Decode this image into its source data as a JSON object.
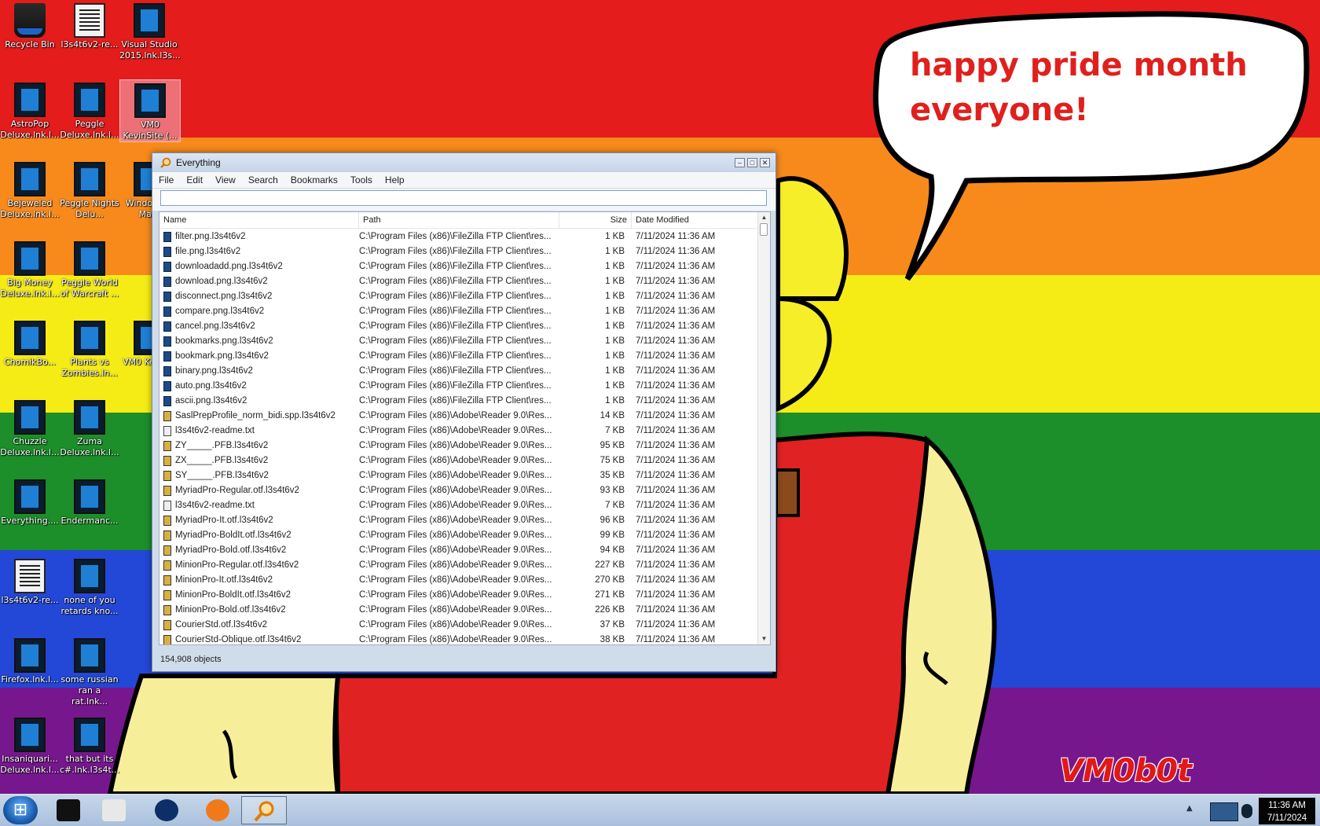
{
  "wallpaper": {
    "speech_line1": "happy pride month",
    "speech_line2": "everyone!",
    "signature": "VM0b0t",
    "stripe_colors": [
      "#e41c1c",
      "#f88a1c",
      "#f6ec15",
      "#1c8e2a",
      "#2347d6",
      "#76178e"
    ]
  },
  "desktop_icons": [
    {
      "label": "Recycle Bin",
      "icon": "recycle-bin-icon"
    },
    {
      "label": "l3s4t6v2-re...",
      "icon": "text-document-icon"
    },
    {
      "label": "Visual Studio 2015.lnk.l3s...",
      "icon": "shortcut-icon"
    },
    {
      "label": "AstroPop Deluxe.lnk.l...",
      "icon": "shortcut-icon"
    },
    {
      "label": "Peggle Deluxe.lnk.l...",
      "icon": "shortcut-icon"
    },
    {
      "label": "VM0 KevinSite (...",
      "icon": "shortcut-icon"
    },
    {
      "label": "Bejeweled Deluxe.lnk.l...",
      "icon": "shortcut-icon"
    },
    {
      "label": "Peggle Nights Delu...",
      "icon": "shortcut-icon"
    },
    {
      "label": "Windo Live Ma...",
      "icon": "shortcut-icon"
    },
    {
      "label": "Big Money Deluxe.lnk.l...",
      "icon": "shortcut-icon"
    },
    {
      "label": "Peggle World of Warcraft ...",
      "icon": "shortcut-icon"
    },
    {
      "label": "ChomikBo...",
      "icon": "shortcut-icon"
    },
    {
      "label": "Plants vs Zombies.ln...",
      "icon": "shortcut-icon"
    },
    {
      "label": "VM0 Kevin...",
      "icon": "shortcut-icon"
    },
    {
      "label": "Chuzzle Deluxe.lnk.l...",
      "icon": "shortcut-icon"
    },
    {
      "label": "Zuma Deluxe.lnk.l...",
      "icon": "shortcut-icon"
    },
    {
      "label": "Everything....",
      "icon": "shortcut-icon"
    },
    {
      "label": "Endermanc...",
      "icon": "shortcut-icon"
    },
    {
      "label": "l3s4t6v2-re...",
      "icon": "text-document-icon"
    },
    {
      "label": "none of you retards kno...",
      "icon": "shortcut-icon"
    },
    {
      "label": "Firefox.lnk.l...",
      "icon": "shortcut-icon"
    },
    {
      "label": "some russian ran a rat.lnk...",
      "icon": "shortcut-icon"
    },
    {
      "label": "Insaniquari... Deluxe.lnk.l...",
      "icon": "shortcut-icon"
    },
    {
      "label": "that but its c#.lnk.l3s4t...",
      "icon": "shortcut-icon"
    }
  ],
  "window": {
    "title": "Everything",
    "menu": [
      "File",
      "Edit",
      "View",
      "Search",
      "Bookmarks",
      "Tools",
      "Help"
    ],
    "search_value": "",
    "columns": {
      "name": "Name",
      "path": "Path",
      "size": "Size",
      "date": "Date Modified"
    },
    "rows": [
      {
        "name": "filter.png.l3s4t6v2",
        "path": "C:\\Program Files (x86)\\FileZilla FTP Client\\res...",
        "size": "1 KB",
        "date": "7/11/2024 11:36 AM",
        "type": "file"
      },
      {
        "name": "file.png.l3s4t6v2",
        "path": "C:\\Program Files (x86)\\FileZilla FTP Client\\res...",
        "size": "1 KB",
        "date": "7/11/2024 11:36 AM",
        "type": "file"
      },
      {
        "name": "downloadadd.png.l3s4t6v2",
        "path": "C:\\Program Files (x86)\\FileZilla FTP Client\\res...",
        "size": "1 KB",
        "date": "7/11/2024 11:36 AM",
        "type": "file"
      },
      {
        "name": "download.png.l3s4t6v2",
        "path": "C:\\Program Files (x86)\\FileZilla FTP Client\\res...",
        "size": "1 KB",
        "date": "7/11/2024 11:36 AM",
        "type": "file"
      },
      {
        "name": "disconnect.png.l3s4t6v2",
        "path": "C:\\Program Files (x86)\\FileZilla FTP Client\\res...",
        "size": "1 KB",
        "date": "7/11/2024 11:36 AM",
        "type": "file"
      },
      {
        "name": "compare.png.l3s4t6v2",
        "path": "C:\\Program Files (x86)\\FileZilla FTP Client\\res...",
        "size": "1 KB",
        "date": "7/11/2024 11:36 AM",
        "type": "file"
      },
      {
        "name": "cancel.png.l3s4t6v2",
        "path": "C:\\Program Files (x86)\\FileZilla FTP Client\\res...",
        "size": "1 KB",
        "date": "7/11/2024 11:36 AM",
        "type": "file"
      },
      {
        "name": "bookmarks.png.l3s4t6v2",
        "path": "C:\\Program Files (x86)\\FileZilla FTP Client\\res...",
        "size": "1 KB",
        "date": "7/11/2024 11:36 AM",
        "type": "file"
      },
      {
        "name": "bookmark.png.l3s4t6v2",
        "path": "C:\\Program Files (x86)\\FileZilla FTP Client\\res...",
        "size": "1 KB",
        "date": "7/11/2024 11:36 AM",
        "type": "file"
      },
      {
        "name": "binary.png.l3s4t6v2",
        "path": "C:\\Program Files (x86)\\FileZilla FTP Client\\res...",
        "size": "1 KB",
        "date": "7/11/2024 11:36 AM",
        "type": "file"
      },
      {
        "name": "auto.png.l3s4t6v2",
        "path": "C:\\Program Files (x86)\\FileZilla FTP Client\\res...",
        "size": "1 KB",
        "date": "7/11/2024 11:36 AM",
        "type": "file"
      },
      {
        "name": "ascii.png.l3s4t6v2",
        "path": "C:\\Program Files (x86)\\FileZilla FTP Client\\res...",
        "size": "1 KB",
        "date": "7/11/2024 11:36 AM",
        "type": "file"
      },
      {
        "name": "SaslPrepProfile_norm_bidi.spp.l3s4t6v2",
        "path": "C:\\Program Files (x86)\\Adobe\\Reader 9.0\\Res...",
        "size": "14 KB",
        "date": "7/11/2024 11:36 AM",
        "type": "font"
      },
      {
        "name": "l3s4t6v2-readme.txt",
        "path": "C:\\Program Files (x86)\\Adobe\\Reader 9.0\\Res...",
        "size": "7 KB",
        "date": "7/11/2024 11:36 AM",
        "type": "txt"
      },
      {
        "name": "ZY_____.PFB.l3s4t6v2",
        "path": "C:\\Program Files (x86)\\Adobe\\Reader 9.0\\Res...",
        "size": "95 KB",
        "date": "7/11/2024 11:36 AM",
        "type": "font"
      },
      {
        "name": "ZX_____.PFB.l3s4t6v2",
        "path": "C:\\Program Files (x86)\\Adobe\\Reader 9.0\\Res...",
        "size": "75 KB",
        "date": "7/11/2024 11:36 AM",
        "type": "font"
      },
      {
        "name": "SY_____.PFB.l3s4t6v2",
        "path": "C:\\Program Files (x86)\\Adobe\\Reader 9.0\\Res...",
        "size": "35 KB",
        "date": "7/11/2024 11:36 AM",
        "type": "font"
      },
      {
        "name": "MyriadPro-Regular.otf.l3s4t6v2",
        "path": "C:\\Program Files (x86)\\Adobe\\Reader 9.0\\Res...",
        "size": "93 KB",
        "date": "7/11/2024 11:36 AM",
        "type": "font"
      },
      {
        "name": "l3s4t6v2-readme.txt",
        "path": "C:\\Program Files (x86)\\Adobe\\Reader 9.0\\Res...",
        "size": "7 KB",
        "date": "7/11/2024 11:36 AM",
        "type": "txt"
      },
      {
        "name": "MyriadPro-It.otf.l3s4t6v2",
        "path": "C:\\Program Files (x86)\\Adobe\\Reader 9.0\\Res...",
        "size": "96 KB",
        "date": "7/11/2024 11:36 AM",
        "type": "font"
      },
      {
        "name": "MyriadPro-BoldIt.otf.l3s4t6v2",
        "path": "C:\\Program Files (x86)\\Adobe\\Reader 9.0\\Res...",
        "size": "99 KB",
        "date": "7/11/2024 11:36 AM",
        "type": "font"
      },
      {
        "name": "MyriadPro-Bold.otf.l3s4t6v2",
        "path": "C:\\Program Files (x86)\\Adobe\\Reader 9.0\\Res...",
        "size": "94 KB",
        "date": "7/11/2024 11:36 AM",
        "type": "font"
      },
      {
        "name": "MinionPro-Regular.otf.l3s4t6v2",
        "path": "C:\\Program Files (x86)\\Adobe\\Reader 9.0\\Res...",
        "size": "227 KB",
        "date": "7/11/2024 11:36 AM",
        "type": "font"
      },
      {
        "name": "MinionPro-It.otf.l3s4t6v2",
        "path": "C:\\Program Files (x86)\\Adobe\\Reader 9.0\\Res...",
        "size": "270 KB",
        "date": "7/11/2024 11:36 AM",
        "type": "font"
      },
      {
        "name": "MinionPro-BoldIt.otf.l3s4t6v2",
        "path": "C:\\Program Files (x86)\\Adobe\\Reader 9.0\\Res...",
        "size": "271 KB",
        "date": "7/11/2024 11:36 AM",
        "type": "font"
      },
      {
        "name": "MinionPro-Bold.otf.l3s4t6v2",
        "path": "C:\\Program Files (x86)\\Adobe\\Reader 9.0\\Res...",
        "size": "226 KB",
        "date": "7/11/2024 11:36 AM",
        "type": "font"
      },
      {
        "name": "CourierStd.otf.l3s4t6v2",
        "path": "C:\\Program Files (x86)\\Adobe\\Reader 9.0\\Res...",
        "size": "37 KB",
        "date": "7/11/2024 11:36 AM",
        "type": "font"
      },
      {
        "name": "CourierStd-Oblique.otf.l3s4t6v2",
        "path": "C:\\Program Files (x86)\\Adobe\\Reader 9.0\\Res...",
        "size": "38 KB",
        "date": "7/11/2024 11:36 AM",
        "type": "font"
      }
    ],
    "status": "154,908 objects"
  },
  "taskbar": {
    "buttons": [
      {
        "icon": "terminal-icon",
        "active": false
      },
      {
        "icon": "media-player-icon",
        "active": false
      },
      {
        "icon": "globe-icon",
        "active": false
      },
      {
        "icon": "firefox-icon",
        "active": false
      },
      {
        "icon": "everything-search-icon",
        "active": true
      }
    ],
    "show_hidden_icon": "▲",
    "time": "11:36 AM",
    "date": "7/11/2024"
  }
}
